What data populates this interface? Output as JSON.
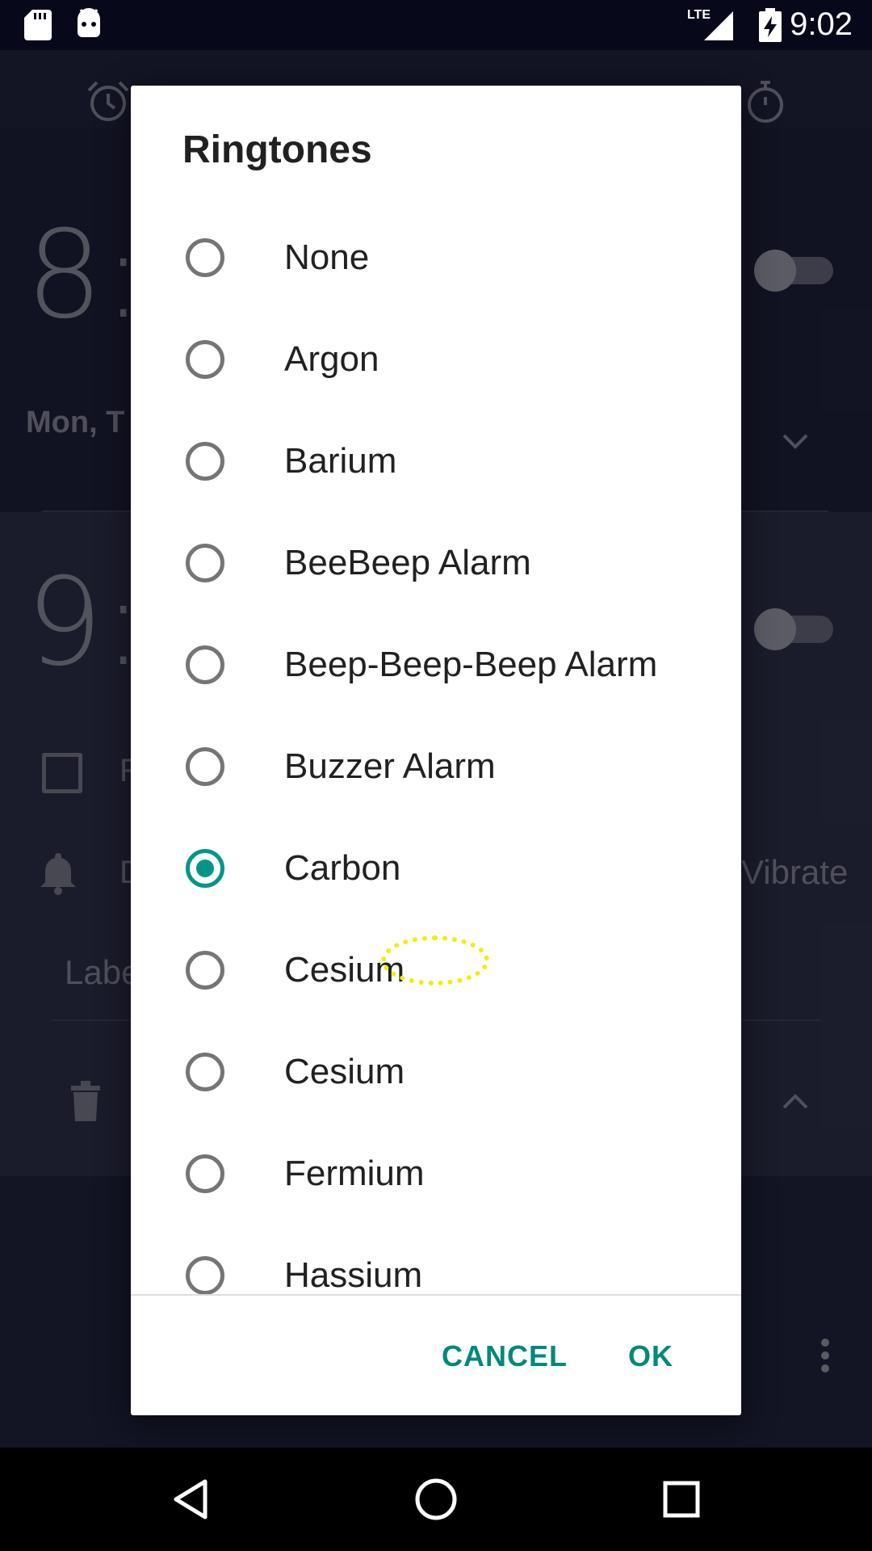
{
  "status_bar": {
    "time": "9:02",
    "network": "LTE",
    "icons": [
      "sd-card-icon",
      "android-icon",
      "signal-icon",
      "battery-charging-icon"
    ]
  },
  "background_app": {
    "tab_icons": [
      "alarm-clock-icon",
      "clock-icon",
      "timer-icon",
      "stopwatch-icon"
    ],
    "alarm1": {
      "time": "8:",
      "days": "Mon, T"
    },
    "alarm2": {
      "time": "9:",
      "repeat": "R",
      "ringtone": "D",
      "vibrate": "Vibrate",
      "label": "Labe"
    }
  },
  "dialog": {
    "title": "Ringtones",
    "items": [
      {
        "label": "None",
        "checked": false
      },
      {
        "label": "Argon",
        "checked": false
      },
      {
        "label": "Barium",
        "checked": false
      },
      {
        "label": "BeeBeep Alarm",
        "checked": false
      },
      {
        "label": "Beep-Beep-Beep Alarm",
        "checked": false
      },
      {
        "label": "Buzzer Alarm",
        "checked": false
      },
      {
        "label": "Carbon",
        "checked": true
      },
      {
        "label": "Cesium",
        "checked": false
      },
      {
        "label": "Cesium",
        "checked": false
      },
      {
        "label": "Fermium",
        "checked": false
      },
      {
        "label": "Hassium",
        "checked": false
      }
    ],
    "cancel_label": "CANCEL",
    "ok_label": "OK"
  },
  "colors": {
    "accent": "#009688",
    "tap_indicator": "#f0f000"
  },
  "nav_bar": {
    "icons": [
      "back-icon",
      "home-icon",
      "recents-icon"
    ]
  }
}
